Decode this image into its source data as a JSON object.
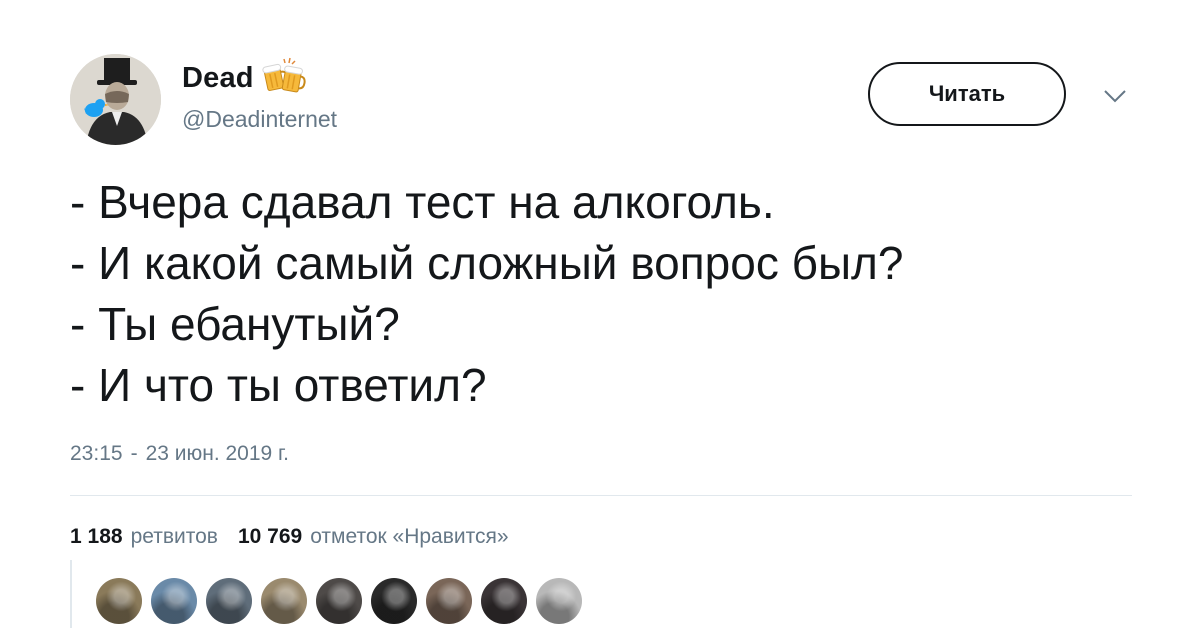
{
  "author": {
    "display_name": "Dead",
    "handle": "@Deadinternet",
    "name_icon": "beer-mugs-icon",
    "avatar": "avatar-gentleman-top-hat"
  },
  "follow_button": {
    "label": "Читать"
  },
  "menu": {
    "icon": "chevron-down-icon"
  },
  "tweet": {
    "lines": [
      "- Вчера сдавал тест на алкоголь.",
      "- И какой самый сложный вопрос был?",
      "- Ты ебанутый?",
      "- И что ты ответил?"
    ]
  },
  "meta": {
    "time": "23:15",
    "separator": "-",
    "date": "23 июн. 2019 г."
  },
  "stats": {
    "retweets": {
      "count": "1 188",
      "label": "ретвитов"
    },
    "likes": {
      "count": "10 769",
      "label": "отметок «Нравится»"
    }
  },
  "likers": [
    {
      "color": "#8a7a5a"
    },
    {
      "color": "#6a8aa8"
    },
    {
      "color": "#5f6d7a"
    },
    {
      "color": "#9a8a6e"
    },
    {
      "color": "#4e4a48"
    },
    {
      "color": "#2a2a2a"
    },
    {
      "color": "#7a6658"
    },
    {
      "color": "#3a3436"
    },
    {
      "color": "#b8b8b8"
    }
  ],
  "colors": {
    "text_primary": "#14171a",
    "text_secondary": "#657786",
    "divider": "#e1e8ed",
    "avatar_bird": "#1da1f2"
  }
}
